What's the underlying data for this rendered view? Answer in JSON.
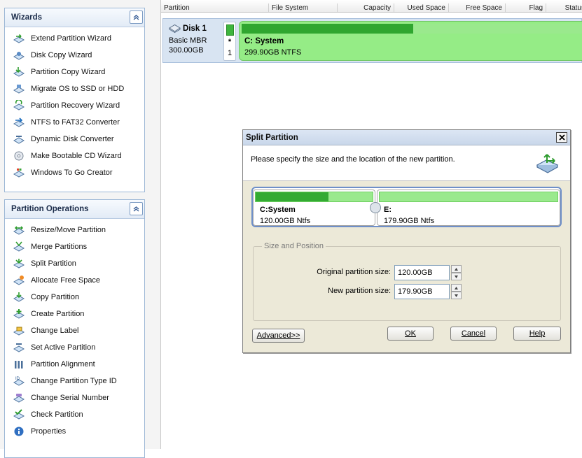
{
  "sidebar": {
    "wizards": {
      "title": "Wizards",
      "items": [
        {
          "label": "Extend Partition Wizard",
          "icon": "extend-partition-icon"
        },
        {
          "label": "Disk Copy Wizard",
          "icon": "disk-copy-icon"
        },
        {
          "label": "Partition Copy Wizard",
          "icon": "partition-copy-icon"
        },
        {
          "label": "Migrate OS to SSD or HDD",
          "icon": "migrate-os-icon"
        },
        {
          "label": "Partition Recovery Wizard",
          "icon": "partition-recovery-icon"
        },
        {
          "label": "NTFS to FAT32 Converter",
          "icon": "ntfs-fat32-icon"
        },
        {
          "label": "Dynamic Disk Converter",
          "icon": "dynamic-disk-icon"
        },
        {
          "label": "Make Bootable CD Wizard",
          "icon": "bootable-cd-icon"
        },
        {
          "label": "Windows To Go Creator",
          "icon": "windows-to-go-icon"
        }
      ]
    },
    "operations": {
      "title": "Partition Operations",
      "items": [
        {
          "label": "Resize/Move Partition",
          "icon": "resize-move-icon"
        },
        {
          "label": "Merge Partitions",
          "icon": "merge-icon"
        },
        {
          "label": "Split Partition",
          "icon": "split-icon"
        },
        {
          "label": "Allocate Free Space",
          "icon": "allocate-icon"
        },
        {
          "label": "Copy Partition",
          "icon": "copy-partition-icon"
        },
        {
          "label": "Create Partition",
          "icon": "create-partition-icon"
        },
        {
          "label": "Change Label",
          "icon": "change-label-icon"
        },
        {
          "label": "Set Active Partition",
          "icon": "set-active-icon"
        },
        {
          "label": "Partition Alignment",
          "icon": "alignment-icon"
        },
        {
          "label": "Change Partition Type ID",
          "icon": "type-id-icon"
        },
        {
          "label": "Change Serial Number",
          "icon": "serial-number-icon"
        },
        {
          "label": "Check Partition",
          "icon": "check-partition-icon"
        },
        {
          "label": "Properties",
          "icon": "properties-icon"
        }
      ]
    }
  },
  "table": {
    "columns": [
      "Partition",
      "File System",
      "Capacity",
      "Used Space",
      "Free Space",
      "Flag",
      "Status"
    ]
  },
  "disk": {
    "name": "Disk 1",
    "type": "Basic MBR",
    "size": "300.00GB",
    "mark_star": "*",
    "mark_num": "1",
    "partition_name": "C: System",
    "partition_info": "299.90GB NTFS",
    "used_fraction": 0.5
  },
  "dialog": {
    "title": "Split Partition",
    "message": "Please specify the size and the location of the new partition.",
    "left": {
      "name": "C:System",
      "size": "120.00GB Ntfs",
      "used_fraction": 0.62
    },
    "right": {
      "name": "E:",
      "size": "179.90GB Ntfs",
      "used_fraction": 0.0
    },
    "group_title": "Size and Position",
    "original_label": "Original partition size:",
    "original_value": "120.00GB",
    "new_label": "New partition size:",
    "new_value": "179.90GB",
    "buttons": {
      "advanced": "Advanced>>",
      "ok": "OK",
      "cancel": "Cancel",
      "help": "Help"
    }
  },
  "colors": {
    "used_green": "#2fa62f",
    "free_green": "#9ae98d",
    "panel_border": "#9cb7d6",
    "dialog_bg": "#ece9d8"
  }
}
